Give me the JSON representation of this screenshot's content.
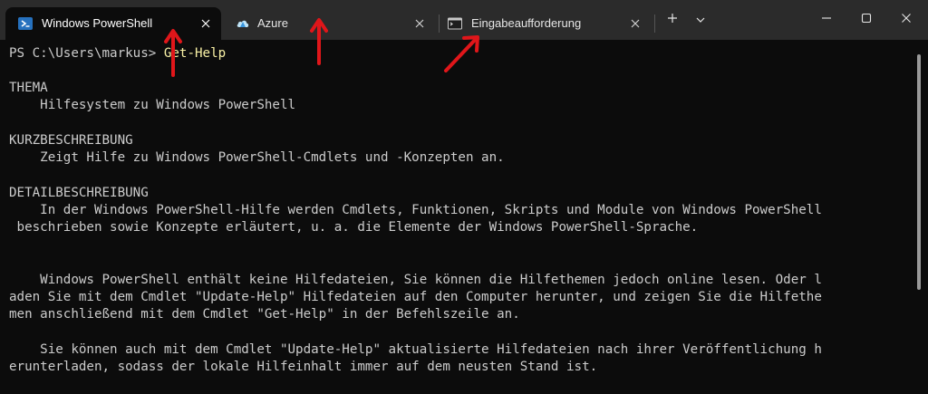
{
  "tabs": [
    {
      "label": "Windows PowerShell",
      "icon": "powershell-icon",
      "active": true
    },
    {
      "label": "Azure",
      "icon": "azure-cloud-icon",
      "active": false
    },
    {
      "label": "Eingabeaufforderung",
      "icon": "cmd-icon",
      "active": false
    }
  ],
  "titlebar_icons": {
    "new_tab": "plus-icon",
    "dropdown": "chevron-down-icon",
    "minimize": "minimize-icon",
    "maximize": "maximize-icon",
    "close": "close-icon"
  },
  "terminal": {
    "prompt": "PS C:\\Users\\markus>",
    "command": "Get-Help",
    "lines": [
      "THEMA",
      "    Hilfesystem zu Windows PowerShell",
      "KURZBESCHREIBUNG",
      "    Zeigt Hilfe zu Windows PowerShell-Cmdlets und -Konzepten an.",
      "DETAILBESCHREIBUNG",
      "    In der Windows PowerShell-Hilfe werden Cmdlets, Funktionen, Skripts und Module von Windows PowerShell",
      " beschrieben sowie Konzepte erläutert, u. a. die Elemente der Windows PowerShell-Sprache.",
      "    Windows PowerShell enthält keine Hilfedateien, Sie können die Hilfethemen jedoch online lesen. Oder l",
      "aden Sie mit dem Cmdlet \"Update-Help\" Hilfedateien auf den Computer herunter, und zeigen Sie die Hilfethe",
      "men anschließend mit dem Cmdlet \"Get-Help\" in der Befehlszeile an.",
      "    Sie können auch mit dem Cmdlet \"Update-Help\" aktualisierte Hilfedateien nach ihrer Veröffentlichung h",
      "erunterladen, sodass der lokale Hilfeinhalt immer auf dem neusten Stand ist."
    ]
  },
  "colors": {
    "titlebar": "#2b2b2b",
    "terminal_bg": "#0c0c0c",
    "terminal_text": "#cccccc",
    "command_text": "#f9f1a5",
    "annotation_arrow": "#e0161a"
  }
}
